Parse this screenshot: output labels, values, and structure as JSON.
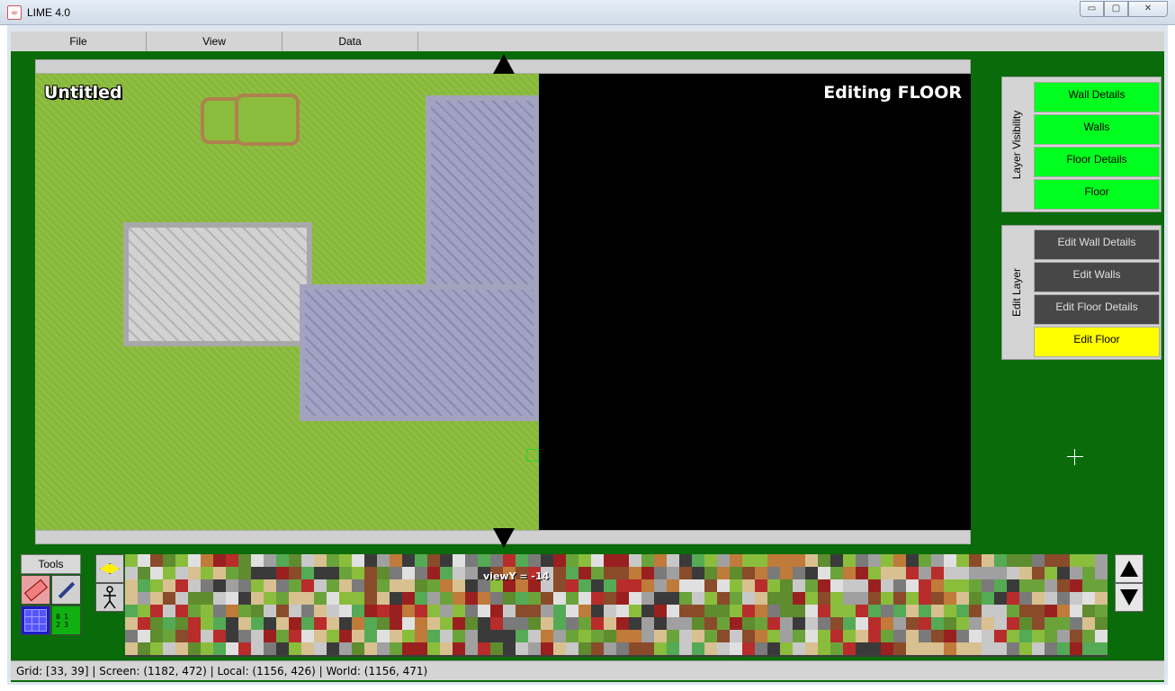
{
  "window": {
    "title": "LIME 4.0",
    "controls": {
      "minimize": "▭",
      "maximize": "▢",
      "close": "✕"
    }
  },
  "menu": [
    "File",
    "View",
    "Data"
  ],
  "map": {
    "title": "Untitled",
    "mode": "Editing FLOOR"
  },
  "layer_visibility": {
    "label": "Layer Visibility",
    "items": [
      "Wall Details",
      "Walls",
      "Floor Details",
      "Floor"
    ],
    "on_color": "#00ff1e"
  },
  "edit_layer": {
    "label": "Edit Layer",
    "items": [
      "Edit Wall Details",
      "Edit Walls",
      "Edit Floor Details",
      "Edit Floor"
    ],
    "selected": "Edit Floor",
    "selected_color": "#ffff00",
    "unselected_color": "#474747"
  },
  "tools": {
    "label": "Tools",
    "icons": [
      "eraser-icon",
      "eyedropper-icon",
      "grid-icon",
      "tile-numbers-icon",
      "diamond-icon",
      "stick-figure-icon"
    ],
    "numbers": [
      "0",
      "1",
      "",
      "2",
      "3",
      ""
    ]
  },
  "palette": {
    "viewY": "viewY = -14"
  },
  "status": {
    "text": "Grid: [33, 39]  |  Screen: (1182, 472)  |  Local: (1156, 426)  |  World: (1156, 471)"
  },
  "colors": {
    "background": "#0a6b0a",
    "grass": "#8bbd3c"
  }
}
